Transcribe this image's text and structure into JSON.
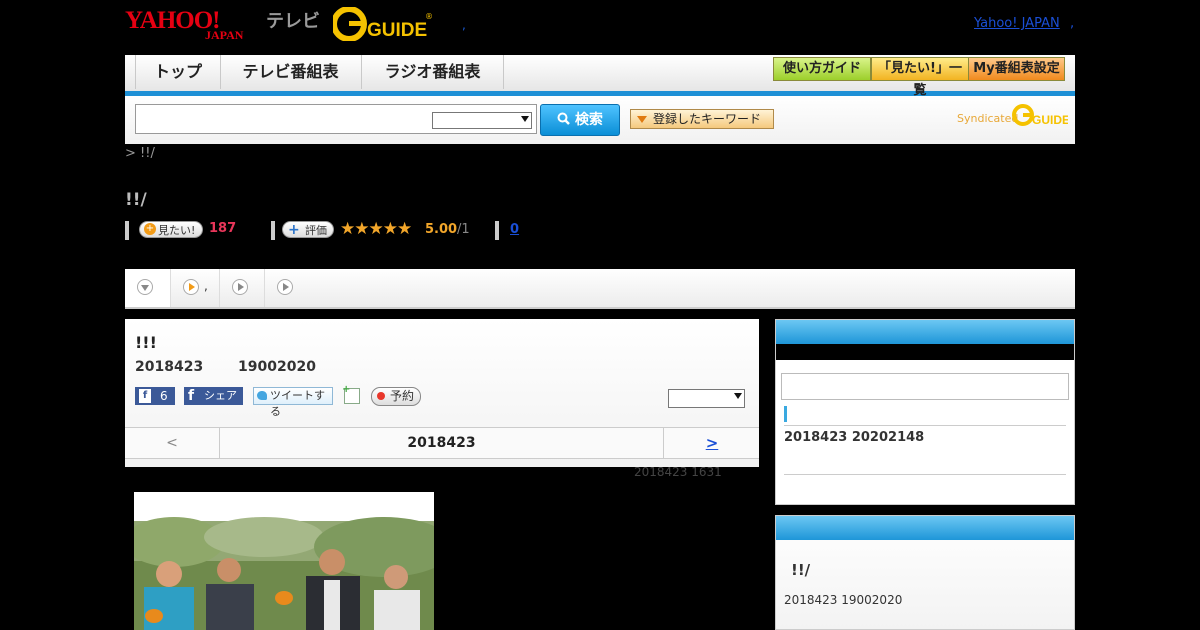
{
  "header": {
    "logo_text": "YAHOO! JAPAN",
    "tv_label": "テレビ",
    "gguide_logo_text": "G GUIDE",
    "separator": ",",
    "yahoo_link": "Yahoo! JAPAN",
    "yahoo_link_suffix": ","
  },
  "nav": {
    "tabs": [
      {
        "label": "トップ"
      },
      {
        "label": "テレビ番組表"
      },
      {
        "label": "ラジオ番組表"
      }
    ],
    "buttons": [
      {
        "label": "使い方ガイド"
      },
      {
        "label": "「見たい!」一覧"
      },
      {
        "label": "My番組表設定"
      }
    ]
  },
  "search": {
    "input_value": "",
    "select_value": "",
    "button_label": "検索",
    "keyword_button_label": "登録したキーワード",
    "syndicated_label": "Syndicated",
    "syndicated_logo_text": "G GUIDE"
  },
  "breadcrumb": "> !!/",
  "program_title": "!!/",
  "stats": {
    "mitai_label": "見たい!",
    "mitai_count": "187",
    "hyoka_label": "評価",
    "stars": "★★★★★",
    "rating": "5.00",
    "rating_count": "/1",
    "comment_count": "0"
  },
  "tabs_row": {
    "tab2_text": ","
  },
  "episode": {
    "title": "!!!",
    "date": "2018423",
    "time": "19002020",
    "fb_like_count": "6",
    "fb_share_label": "シェア",
    "tweet_label": "ツイートする",
    "reserve_label": "予約",
    "select_value": "",
    "date_nav": {
      "prev": "<",
      "current": "2018423",
      "next": ">"
    },
    "updated": "2018423  1631"
  },
  "right_col": {
    "box1": {
      "field_value": "",
      "date": "2018423  20202148"
    },
    "box2": {
      "title": "!!/",
      "date": "2018423  19002020"
    }
  },
  "colors": {
    "accent_blue": "#1e90d6",
    "star_orange": "#f2a62a",
    "mitai_red": "#e8365a",
    "link_blue": "#1a4fd6"
  }
}
